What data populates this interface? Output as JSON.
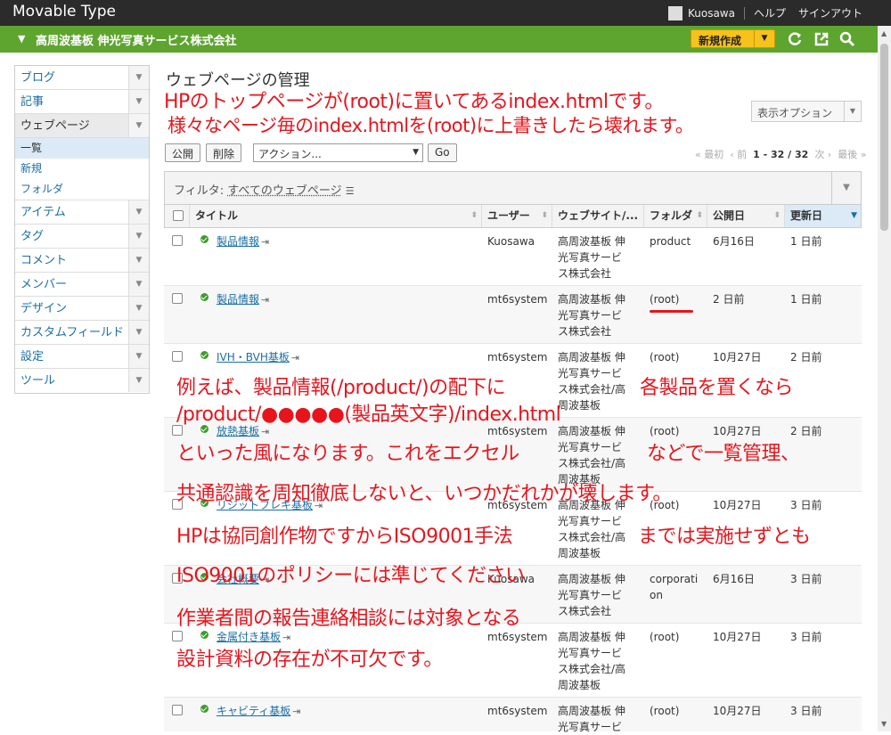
{
  "app": {
    "name": "Movable Type",
    "user": "Kuosawa",
    "help": "ヘルプ",
    "signout": "サインアウト"
  },
  "site": {
    "name": "高周波基板 伸光写真サービス株式会社",
    "new_button": "新規作成"
  },
  "sidebar": {
    "items": [
      {
        "label": "ブログ"
      },
      {
        "label": "記事"
      },
      {
        "label": "ウェブページ"
      },
      {
        "label": "アイテム"
      },
      {
        "label": "タグ"
      },
      {
        "label": "コメント"
      },
      {
        "label": "メンバー"
      },
      {
        "label": "デザイン"
      },
      {
        "label": "カスタムフィールド"
      },
      {
        "label": "設定"
      },
      {
        "label": "ツール"
      }
    ],
    "sub": [
      {
        "label": "一覧"
      },
      {
        "label": "新規"
      },
      {
        "label": "フォルダ"
      }
    ]
  },
  "main": {
    "title": "ウェブページの管理",
    "display_options": "表示オプション",
    "publish": "公開",
    "delete": "削除",
    "action_placeholder": "アクション...",
    "go": "Go",
    "pager": {
      "first": "« 最初",
      "prev": "‹ 前",
      "range": "1 - 32 / 32",
      "next": "次 ›",
      "last": "最後 »"
    },
    "filter_label": "フィルタ:",
    "filter_value": "すべてのウェブページ",
    "columns": [
      "タイトル",
      "ユーザー",
      "ウェブサイト/...",
      "フォルダ",
      "公開日",
      "更新日"
    ]
  },
  "rows": [
    {
      "title": "製品情報",
      "user": "Kuosawa",
      "site": "高周波基板 伸|光写真サービ|ス株式会社",
      "folder": "product",
      "published": "6月16日",
      "updated": "1 日前"
    },
    {
      "title": "製品情報",
      "user": "mt6system",
      "site": "高周波基板 伸|光写真サービ|ス株式会社",
      "folder": "(root)",
      "published": "2 日前",
      "updated": "1 日前"
    },
    {
      "title": "IVH・BVH基板",
      "user": "mt6system",
      "site": "高周波基板 伸|光写真サービ|ス株式会社/高|周波基板",
      "folder": "(root)",
      "published": "10月27日",
      "updated": "2 日前"
    },
    {
      "title": "放熱基板",
      "user": "mt6system",
      "site": "高周波基板 伸|光写真サービ|ス株式会社/高|周波基板",
      "folder": "(root)",
      "published": "10月27日",
      "updated": "2 日前"
    },
    {
      "title": "リジットフレキ基板",
      "user": "mt6system",
      "site": "高周波基板 伸|光写真サービ|ス株式会社/高|周波基板",
      "folder": "(root)",
      "published": "10月27日",
      "updated": "3 日前"
    },
    {
      "title": "会社概要",
      "user": "Kuosawa",
      "site": "高周波基板 伸|光写真サービ|ス株式会社",
      "folder": "corporati|on",
      "published": "6月16日",
      "updated": "3 日前"
    },
    {
      "title": "金属付き基板",
      "user": "mt6system",
      "site": "高周波基板 伸|光写真サービ|ス株式会社/高|周波基板",
      "folder": "(root)",
      "published": "10月27日",
      "updated": "3 日前"
    },
    {
      "title": "キャビティ基板",
      "user": "mt6system",
      "site": "高周波基板 伸|光写真サービ",
      "folder": "(root)",
      "published": "10月27日",
      "updated": "3 日前"
    }
  ],
  "annotations": {
    "a1": "HPのトップページが(root)に置いてあるindex.htmlです。",
    "a2": "様々なページ毎のindex.htmlを(root)に上書きしたら壊れます。",
    "a3a": "例えば、製品情報(/product/)の配下に",
    "a3b": "各製品を置くなら",
    "a4": "/product/●●●●●(製品英文字)/index.html",
    "a5a": "といった風になります。これをエクセル",
    "a5b": "などで一覧管理、",
    "a6": "共通認識を周知徹底しないと、いつかだれかが壊します。",
    "a7a": "HPは協同創作物ですからISO9001手法",
    "a7b": "までは実施せずとも",
    "a8": "ISO9001のポリシーには準じてください",
    "a9": "作業者間の報告連絡相談には対象となる",
    "a10": "設計資料の存在が不可欠です。"
  },
  "colors": {
    "accent": "#5ea52f",
    "annotation": "#e8141c",
    "link": "#1a6fa5",
    "new_button": "#f7c21c"
  }
}
